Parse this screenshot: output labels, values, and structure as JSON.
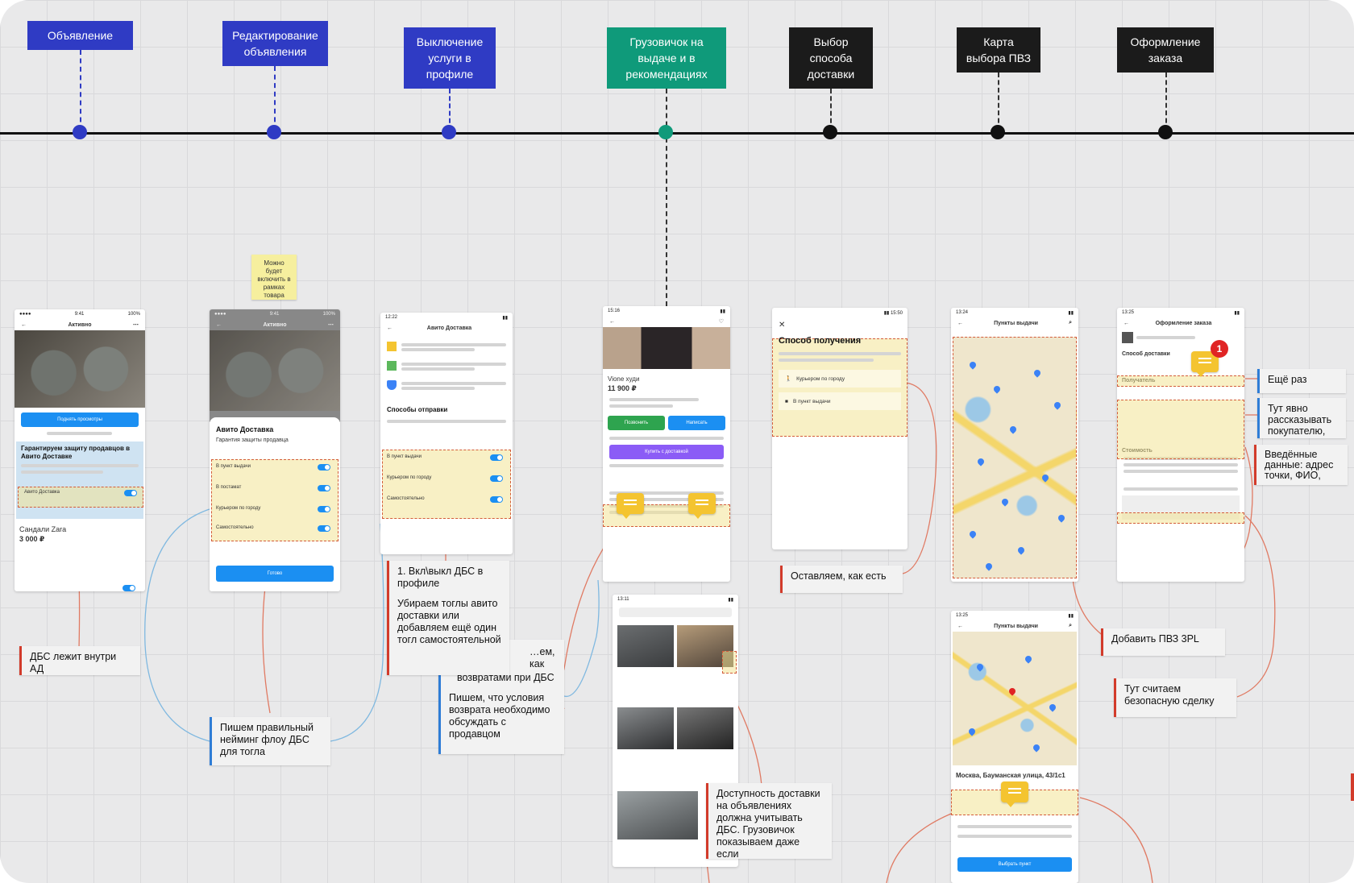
{
  "stages": [
    {
      "label": "Объявление",
      "color": "blue"
    },
    {
      "label": "Редактирование объявления",
      "color": "blue"
    },
    {
      "label": "Выключение услуги в профиле",
      "color": "blue"
    },
    {
      "label": "Грузовичок на выдаче и в рекомендациях",
      "color": "green"
    },
    {
      "label": "Выбор способа доставки",
      "color": "black"
    },
    {
      "label": "Карта выбора ПВЗ",
      "color": "black"
    },
    {
      "label": "Оформление заказа",
      "color": "black"
    }
  ],
  "colors": {
    "stage_blue": "#2f3bc4",
    "stage_green": "#0f9a7a",
    "stage_black": "#1b1b1b",
    "note_red_accent": "#d23b2b",
    "note_blue_accent": "#2f7dd6",
    "connector": "#e07a63"
  },
  "sticky": {
    "text": "Можно будет включить в рамках товара"
  },
  "screens": {
    "ad": {
      "title": "Активно",
      "protect_title": "Гарантируем защиту продавцов в Авито Доставке",
      "delivery_row": "Авито Доставка",
      "item_name": "Сандали Zara",
      "item_price": "3 000 ₽",
      "button": "Поднять просмотры"
    },
    "edit": {
      "title": "Активно",
      "sheet_title": "Авито Доставка",
      "sheet_sub": "Гарантия защиты продавца",
      "rows": [
        "В пункт выдачи",
        "В постамат",
        "Курьером по городу",
        "Самостоятельно"
      ],
      "button": "Готово"
    },
    "profile": {
      "title": "Авито Доставка",
      "section": "Способы отправки",
      "rows": [
        "В пункт выдачи",
        "Курьером по городу",
        "Самостоятельно"
      ]
    },
    "listing": {
      "item_name": "Vione худи",
      "item_price": "11 900 ₽",
      "btn_call": "Позвонить",
      "btn_write": "Написать",
      "btn_buy": "Купить с доставкой"
    },
    "method": {
      "title": "Способ получения",
      "opt1": "Курьером по городу",
      "opt2": "В пункт выдачи"
    },
    "map": {
      "title": "Пункты выдачи"
    },
    "map2": {
      "title": "Пункты выдачи",
      "address": "Москва, Бауманская улица, 43/1с1",
      "button": "Выбрать пункт"
    },
    "checkout": {
      "title": "Оформление заказа",
      "delivery": "Способ доставки",
      "recipient": "Получатель",
      "cost": "Стоимость",
      "badge": "1"
    }
  },
  "notes": {
    "dbs_inside": "ДБС лежит внутри АД",
    "naming": "Пишем правильный нейминг флоу ДБС для тогла",
    "toggle_title": "1. Вкл\\выкл ДБС в профиле",
    "toggle_body": "Убираем тоглы авито доставки или добавляем ещё один тогл самостоятельной",
    "returns_partial": "…ем, как",
    "returns_line2": "возвратами при ДБС",
    "returns_body": "Пишем, что условия возврата необходимо обсуждать с продавцом",
    "keep": "Оставляем, как есть",
    "availability": "Доступность доставки на объявлениях должна учитывать ДБС. Грузовичок показываем даже если",
    "add_pvz": "Добавить ПВЗ 3PL",
    "again": "Ещё раз",
    "tell_buyer": "Тут явно рассказывать покупателю,",
    "entered": "Введённые данные: адрес точки, ФИО,",
    "safe_deal": "Тут считаем безопасную сделку"
  }
}
